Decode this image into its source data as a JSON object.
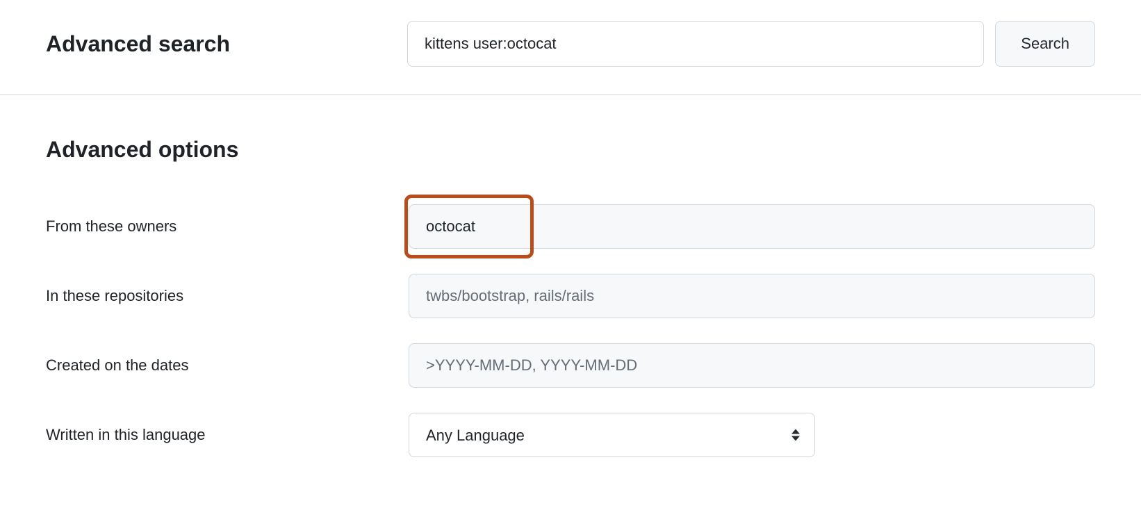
{
  "header": {
    "title": "Advanced search",
    "search_value": "kittens user:octocat",
    "search_button": "Search"
  },
  "options": {
    "title": "Advanced options",
    "rows": {
      "owners": {
        "label": "From these owners",
        "value": "octocat",
        "placeholder": ""
      },
      "repositories": {
        "label": "In these repositories",
        "value": "",
        "placeholder": "twbs/bootstrap, rails/rails"
      },
      "created": {
        "label": "Created on the dates",
        "value": "",
        "placeholder": ">YYYY-MM-DD, YYYY-MM-DD"
      },
      "language": {
        "label": "Written in this language",
        "value": "Any Language"
      }
    }
  }
}
